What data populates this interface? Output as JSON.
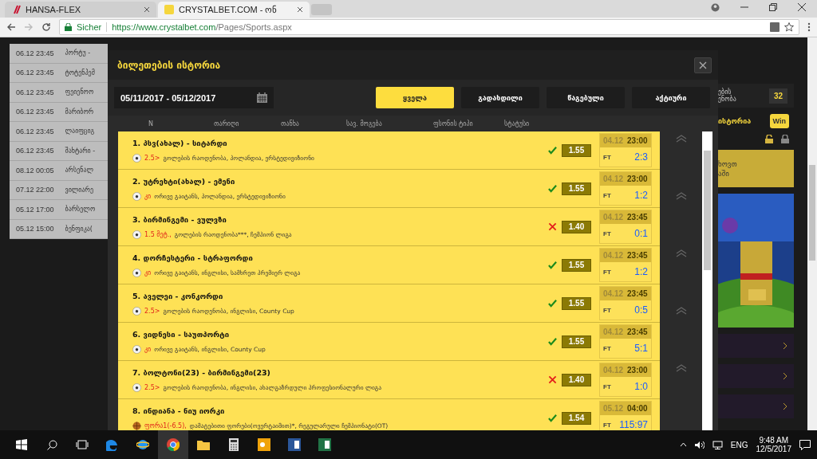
{
  "browser": {
    "tabs": [
      {
        "title": "HANSA-FLEX",
        "selected": false
      },
      {
        "title": "CRYSTALBET.COM - ონ",
        "selected": true
      }
    ],
    "secure_label": "Sicher",
    "url_host": "https://www.crystalbet.com",
    "url_path": "/Pages/Sports.aspx"
  },
  "background_table": [
    {
      "date": "06.12 23:45",
      "text": "პორტუ -"
    },
    {
      "date": "06.12 23:45",
      "text": "ტოტენჰემ"
    },
    {
      "date": "06.12 23:45",
      "text": "ფეიენოო"
    },
    {
      "date": "06.12 23:45",
      "text": "მარიბორ"
    },
    {
      "date": "06.12 23:45",
      "text": "ლაიფციგ"
    },
    {
      "date": "06.12 23:45",
      "text": "შახტარი -"
    },
    {
      "date": "08.12 00:05",
      "text": "არსენალ"
    },
    {
      "date": "07.12 22:00",
      "text": "ვილიარე"
    },
    {
      "date": "05.12 17:00",
      "text": "ბარსელო"
    },
    {
      "date": "05.12 15:00",
      "text": "ბენფიკა("
    }
  ],
  "modal": {
    "title": "ბილეთების ისტორია",
    "date_range": "05/11/2017 - 05/12/2017",
    "filters": [
      {
        "label": "ყველა",
        "selected": true
      },
      {
        "label": "გადახდილი",
        "selected": false
      },
      {
        "label": "წაგებული",
        "selected": false
      },
      {
        "label": "აქტიური",
        "selected": false
      }
    ],
    "columns": [
      "N",
      "თარიღი",
      "თანხა",
      "სავ. მოგება",
      "ფსონის ტიპი",
      "სტატუსი"
    ],
    "tickets": [
      {
        "title": "1. პსვ(ახალ) - სიტარდი",
        "kind": "football",
        "pick": "2.5>",
        "market": "გოლების რაოდენობა, პოლანდია, ერსტედივიზიონი",
        "won": true,
        "odds": "1.55",
        "date": "04.12",
        "time": "23:00",
        "period": "FT",
        "score": "2:3"
      },
      {
        "title": "2. უტრეხტი(ახალ) - ემენი",
        "kind": "football",
        "pick": "კი",
        "market": "ორივე გაიტანს, პოლანდია, ერსტედივიზიონი",
        "won": true,
        "odds": "1.55",
        "date": "04.12",
        "time": "23:00",
        "period": "FT",
        "score": "1:2"
      },
      {
        "title": "3. ბირმინგემი - ვულვზი",
        "kind": "football",
        "pick": "1.5 მეტ.,",
        "market": "გოლების რაოდენობა***, ჩემპიონ ლიგა",
        "won": false,
        "odds": "1.40",
        "date": "04.12",
        "time": "23:45",
        "period": "FT",
        "score": "0:1"
      },
      {
        "title": "4. დორჩესტერი - სტრაფორდი",
        "kind": "football",
        "pick": "კი",
        "market": "ორივე გაიტანს, ინგლისი, სამხრეთ პრემიერ ლიგა",
        "won": true,
        "odds": "1.55",
        "date": "04.12",
        "time": "23:45",
        "period": "FT",
        "score": "1:2"
      },
      {
        "title": "5. აველეი - კონკორდი",
        "kind": "football",
        "pick": "2.5>",
        "market": "გოლების რაოდენობა, ინგლისი, County Cup",
        "won": true,
        "odds": "1.55",
        "date": "04.12",
        "time": "23:45",
        "period": "FT",
        "score": "0:5"
      },
      {
        "title": "6. ვიდნესი - საუთპორტი",
        "kind": "football",
        "pick": "კი",
        "market": "ორივე გაიტანს, ინგლისი, County Cup",
        "won": true,
        "odds": "1.55",
        "date": "04.12",
        "time": "23:45",
        "period": "FT",
        "score": "5:1"
      },
      {
        "title": "7. ბოლტონი(23) - ბირმინგემი(23)",
        "kind": "football",
        "pick": "2.5>",
        "market": "გოლების რაოდენობა, ინგლისი, ახალგაზრდული პროფესიონალური ლიგა",
        "won": false,
        "odds": "1.40",
        "date": "04.12",
        "time": "23:00",
        "period": "FT",
        "score": "1:0"
      },
      {
        "title": "8. ინდიანა - ნიუ იორკი",
        "kind": "basketball",
        "pick": "ფორა1(-6.5),",
        "market": "დამატებითი ფორები(ოვერტაიმით)*, რეგულარული ჩემპიონატი(OT)",
        "won": true,
        "odds": "1.54",
        "date": "05.12",
        "time": "04:00",
        "period": "FT",
        "score": "115:97"
      }
    ]
  },
  "sidebar": {
    "stat_lines": [
      "ების",
      "ენობა"
    ],
    "stat_value": "32",
    "history_label": "ისტორია",
    "badge": "Win",
    "notice_lines": [
      "ხოვთ",
      "აში"
    ]
  },
  "taskbar": {
    "language": "ENG",
    "time": "9:48 AM",
    "date": "12/5/2017"
  }
}
